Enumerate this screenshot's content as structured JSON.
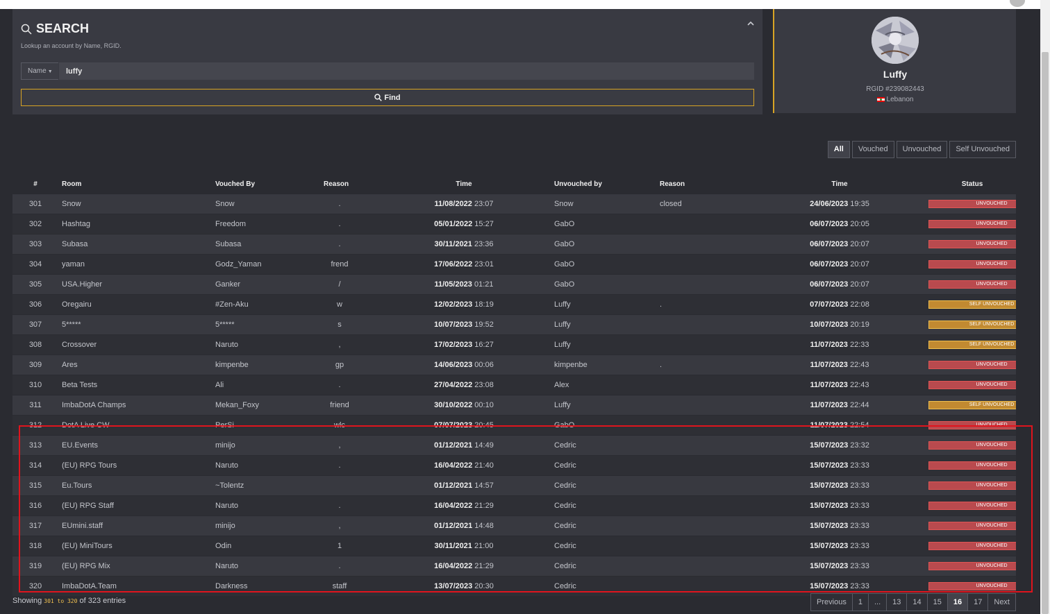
{
  "search": {
    "title": "SEARCH",
    "subtitle": "Lookup an account by Name, RGID.",
    "mode": "Name",
    "query": "luffy",
    "find_label": "Find"
  },
  "profile": {
    "name": "Luffy",
    "rgid": "RGID #239082443",
    "country": "Lebanon"
  },
  "filters": [
    {
      "label": "All",
      "active": true
    },
    {
      "label": "Vouched",
      "active": false
    },
    {
      "label": "Unvouched",
      "active": false
    },
    {
      "label": "Self Unvouched",
      "active": false
    }
  ],
  "table": {
    "headers": [
      "#",
      "Room",
      "Vouched By",
      "Reason",
      "Time",
      "Unvouched by",
      "Reason",
      "Time",
      "Status"
    ],
    "rows": [
      {
        "num": "301",
        "room": "Snow",
        "vouched_by": "Snow",
        "reason": ".",
        "vdate": "11/08/2022",
        "vtime": "23:07",
        "unvouched_by": "Snow",
        "ureason": "closed",
        "udate": "24/06/2023",
        "utime": "19:35",
        "status": "UNVOUCHED",
        "self": false
      },
      {
        "num": "302",
        "room": "Hashtag",
        "vouched_by": "Freedom",
        "reason": ".",
        "vdate": "05/01/2022",
        "vtime": "15:27",
        "unvouched_by": "GabO",
        "ureason": "",
        "udate": "06/07/2023",
        "utime": "20:05",
        "status": "UNVOUCHED",
        "self": false
      },
      {
        "num": "303",
        "room": "Subasa",
        "vouched_by": "Subasa",
        "reason": ".",
        "vdate": "30/11/2021",
        "vtime": "23:36",
        "unvouched_by": "GabO",
        "ureason": "",
        "udate": "06/07/2023",
        "utime": "20:07",
        "status": "UNVOUCHED",
        "self": false
      },
      {
        "num": "304",
        "room": "yaman",
        "vouched_by": "Godz_Yaman",
        "reason": "frend",
        "vdate": "17/06/2022",
        "vtime": "23:01",
        "unvouched_by": "GabO",
        "ureason": "",
        "udate": "06/07/2023",
        "utime": "20:07",
        "status": "UNVOUCHED",
        "self": false
      },
      {
        "num": "305",
        "room": "USA.Higher",
        "vouched_by": "Ganker",
        "reason": "/",
        "vdate": "11/05/2023",
        "vtime": "01:21",
        "unvouched_by": "GabO",
        "ureason": "",
        "udate": "06/07/2023",
        "utime": "20:07",
        "status": "UNVOUCHED",
        "self": false
      },
      {
        "num": "306",
        "room": "Oregairu",
        "vouched_by": "#Zen-Aku",
        "reason": "w",
        "vdate": "12/02/2023",
        "vtime": "18:19",
        "unvouched_by": "Luffy",
        "ureason": ".",
        "udate": "07/07/2023",
        "utime": "22:08",
        "status": "SELF UNVOUCHED",
        "self": true
      },
      {
        "num": "307",
        "room": "5*****",
        "vouched_by": "5*****",
        "reason": "s",
        "vdate": "10/07/2023",
        "vtime": "19:52",
        "unvouched_by": "Luffy",
        "ureason": "",
        "udate": "10/07/2023",
        "utime": "20:19",
        "status": "SELF UNVOUCHED",
        "self": true
      },
      {
        "num": "308",
        "room": "Crossover",
        "vouched_by": "Naruto",
        "reason": ",",
        "vdate": "17/02/2023",
        "vtime": "16:27",
        "unvouched_by": "Luffy",
        "ureason": "",
        "udate": "11/07/2023",
        "utime": "22:33",
        "status": "SELF UNVOUCHED",
        "self": true
      },
      {
        "num": "309",
        "room": "Ares",
        "vouched_by": "kimpenbe",
        "reason": "gp",
        "vdate": "14/06/2023",
        "vtime": "00:06",
        "unvouched_by": "kimpenbe",
        "ureason": ".",
        "udate": "11/07/2023",
        "utime": "22:43",
        "status": "UNVOUCHED",
        "self": false
      },
      {
        "num": "310",
        "room": "Beta Tests",
        "vouched_by": "Ali",
        "reason": ".",
        "vdate": "27/04/2022",
        "vtime": "23:08",
        "unvouched_by": "Alex",
        "ureason": "",
        "udate": "11/07/2023",
        "utime": "22:43",
        "status": "UNVOUCHED",
        "self": false
      },
      {
        "num": "311",
        "room": "ImbaDotA Champs",
        "vouched_by": "Mekan_Foxy",
        "reason": "friend",
        "vdate": "30/10/2022",
        "vtime": "00:10",
        "unvouched_by": "Luffy",
        "ureason": "",
        "udate": "11/07/2023",
        "utime": "22:44",
        "status": "SELF UNVOUCHED",
        "self": true
      },
      {
        "num": "312",
        "room": "DotA Live CW",
        "vouched_by": "PerSi",
        "reason": "wlc",
        "vdate": "07/07/2023",
        "vtime": "20:45",
        "unvouched_by": "GabO",
        "ureason": "",
        "udate": "11/07/2023",
        "utime": "22:54",
        "status": "UNVOUCHED",
        "self": false
      },
      {
        "num": "313",
        "room": "EU.Events",
        "vouched_by": "minijo",
        "reason": ",",
        "vdate": "01/12/2021",
        "vtime": "14:49",
        "unvouched_by": "Cedric",
        "ureason": "",
        "udate": "15/07/2023",
        "utime": "23:32",
        "status": "UNVOUCHED",
        "self": false
      },
      {
        "num": "314",
        "room": "(EU) RPG Tours",
        "vouched_by": "Naruto",
        "reason": ".",
        "vdate": "16/04/2022",
        "vtime": "21:40",
        "unvouched_by": "Cedric",
        "ureason": "",
        "udate": "15/07/2023",
        "utime": "23:33",
        "status": "UNVOUCHED",
        "self": false
      },
      {
        "num": "315",
        "room": "Eu.Tours",
        "vouched_by": "~Tolentz",
        "reason": "",
        "vdate": "01/12/2021",
        "vtime": "14:57",
        "unvouched_by": "Cedric",
        "ureason": "",
        "udate": "15/07/2023",
        "utime": "23:33",
        "status": "UNVOUCHED",
        "self": false
      },
      {
        "num": "316",
        "room": "(EU) RPG Staff",
        "vouched_by": "Naruto",
        "reason": ".",
        "vdate": "16/04/2022",
        "vtime": "21:29",
        "unvouched_by": "Cedric",
        "ureason": "",
        "udate": "15/07/2023",
        "utime": "23:33",
        "status": "UNVOUCHED",
        "self": false
      },
      {
        "num": "317",
        "room": "EUmini.staff",
        "vouched_by": "minijo",
        "reason": ",",
        "vdate": "01/12/2021",
        "vtime": "14:48",
        "unvouched_by": "Cedric",
        "ureason": "",
        "udate": "15/07/2023",
        "utime": "23:33",
        "status": "UNVOUCHED",
        "self": false
      },
      {
        "num": "318",
        "room": "(EU) MiniTours",
        "vouched_by": "Odin",
        "reason": "1",
        "vdate": "30/11/2021",
        "vtime": "21:00",
        "unvouched_by": "Cedric",
        "ureason": "",
        "udate": "15/07/2023",
        "utime": "23:33",
        "status": "UNVOUCHED",
        "self": false
      },
      {
        "num": "319",
        "room": "(EU) RPG Mix",
        "vouched_by": "Naruto",
        "reason": ".",
        "vdate": "16/04/2022",
        "vtime": "21:29",
        "unvouched_by": "Cedric",
        "ureason": "",
        "udate": "15/07/2023",
        "utime": "23:33",
        "status": "UNVOUCHED",
        "self": false
      },
      {
        "num": "320",
        "room": "ImbaDotA.Team",
        "vouched_by": "Darkness",
        "reason": "staff",
        "vdate": "13/07/2023",
        "vtime": "20:30",
        "unvouched_by": "Cedric",
        "ureason": "",
        "udate": "15/07/2023",
        "utime": "23:33",
        "status": "UNVOUCHED",
        "self": false
      }
    ]
  },
  "footer": {
    "showing_prefix": "Showing",
    "showing_range": "301 to 320",
    "showing_suffix": "of 323 entries"
  },
  "pagination": [
    {
      "label": "Previous",
      "active": false
    },
    {
      "label": "1",
      "active": false
    },
    {
      "label": "...",
      "active": false
    },
    {
      "label": "13",
      "active": false
    },
    {
      "label": "14",
      "active": false
    },
    {
      "label": "15",
      "active": false
    },
    {
      "label": "16",
      "active": true
    },
    {
      "label": "17",
      "active": false
    },
    {
      "label": "Next",
      "active": false
    }
  ],
  "colors": {
    "accent": "#d9a424",
    "unvouched": "#b94a4e",
    "self_unvouched": "#c28a31",
    "highlight": "#e0141d"
  }
}
